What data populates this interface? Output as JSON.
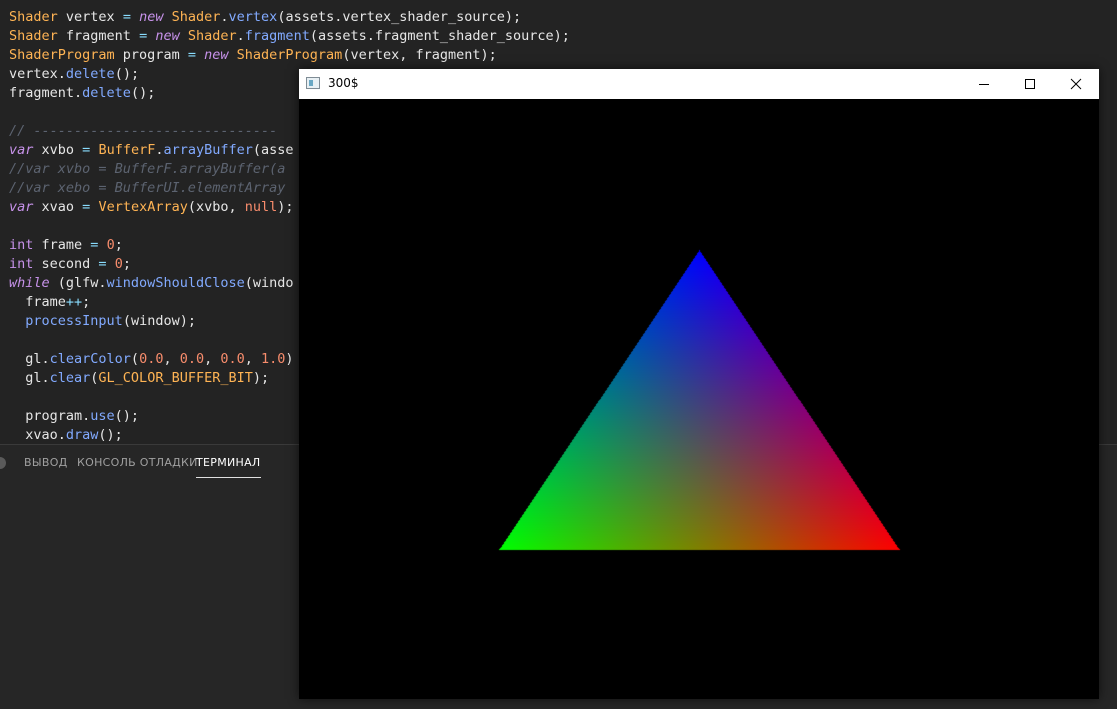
{
  "editor": {
    "lines": [
      [
        [
          "t-type",
          "Shader"
        ],
        [
          "t-plain",
          " vertex "
        ],
        [
          "t-op",
          "="
        ],
        [
          "t-plain",
          " "
        ],
        [
          "t-kw",
          "new"
        ],
        [
          "t-plain",
          " "
        ],
        [
          "t-type",
          "Shader"
        ],
        [
          "t-plain",
          "."
        ],
        [
          "t-call",
          "vertex"
        ],
        [
          "t-plain",
          "(assets.vertex_shader_source);"
        ]
      ],
      [
        [
          "t-type",
          "Shader"
        ],
        [
          "t-plain",
          " fragment "
        ],
        [
          "t-op",
          "="
        ],
        [
          "t-plain",
          " "
        ],
        [
          "t-kw",
          "new"
        ],
        [
          "t-plain",
          " "
        ],
        [
          "t-type",
          "Shader"
        ],
        [
          "t-plain",
          "."
        ],
        [
          "t-call",
          "fragment"
        ],
        [
          "t-plain",
          "(assets.fragment_shader_source);"
        ]
      ],
      [
        [
          "t-type",
          "ShaderProgram"
        ],
        [
          "t-plain",
          " program "
        ],
        [
          "t-op",
          "="
        ],
        [
          "t-plain",
          " "
        ],
        [
          "t-kw",
          "new"
        ],
        [
          "t-plain",
          " "
        ],
        [
          "t-type",
          "ShaderProgram"
        ],
        [
          "t-plain",
          "(vertex, fragment);"
        ]
      ],
      [
        [
          "t-plain",
          "vertex."
        ],
        [
          "t-call",
          "delete"
        ],
        [
          "t-plain",
          "();"
        ]
      ],
      [
        [
          "t-plain",
          "fragment."
        ],
        [
          "t-call",
          "delete"
        ],
        [
          "t-plain",
          "();"
        ]
      ],
      [],
      [
        [
          "t-comment",
          "// ------------------------------"
        ]
      ],
      [
        [
          "t-kw",
          "var"
        ],
        [
          "t-plain",
          " xvbo "
        ],
        [
          "t-op",
          "="
        ],
        [
          "t-plain",
          " "
        ],
        [
          "t-type",
          "BufferF"
        ],
        [
          "t-plain",
          "."
        ],
        [
          "t-call",
          "arrayBuffer"
        ],
        [
          "t-plain",
          "(asse"
        ]
      ],
      [
        [
          "t-comment",
          "//var xvbo = BufferF.arrayBuffer(a"
        ]
      ],
      [
        [
          "t-comment",
          "//var xebo = BufferUI.elementArray"
        ]
      ],
      [
        [
          "t-kw",
          "var"
        ],
        [
          "t-plain",
          " xvao "
        ],
        [
          "t-op",
          "="
        ],
        [
          "t-plain",
          " "
        ],
        [
          "t-type",
          "VertexArray"
        ],
        [
          "t-plain",
          "(xvbo, "
        ],
        [
          "t-null",
          "null"
        ],
        [
          "t-plain",
          ");"
        ]
      ],
      [],
      [
        [
          "t-kw2",
          "int"
        ],
        [
          "t-plain",
          " frame "
        ],
        [
          "t-op",
          "="
        ],
        [
          "t-plain",
          " "
        ],
        [
          "t-num",
          "0"
        ],
        [
          "t-plain",
          ";"
        ]
      ],
      [
        [
          "t-kw2",
          "int"
        ],
        [
          "t-plain",
          " second "
        ],
        [
          "t-op",
          "="
        ],
        [
          "t-plain",
          " "
        ],
        [
          "t-num",
          "0"
        ],
        [
          "t-plain",
          ";"
        ]
      ],
      [
        [
          "t-kw",
          "while"
        ],
        [
          "t-plain",
          " (glfw."
        ],
        [
          "t-call",
          "windowShouldClose"
        ],
        [
          "t-plain",
          "(windo"
        ]
      ],
      [
        [
          "t-plain",
          "  frame"
        ],
        [
          "t-op",
          "++"
        ],
        [
          "t-plain",
          ";"
        ]
      ],
      [
        [
          "t-plain",
          "  "
        ],
        [
          "t-call",
          "processInput"
        ],
        [
          "t-plain",
          "(window);"
        ]
      ],
      [],
      [
        [
          "t-plain",
          "  gl."
        ],
        [
          "t-call",
          "clearColor"
        ],
        [
          "t-plain",
          "("
        ],
        [
          "t-num",
          "0.0"
        ],
        [
          "t-plain",
          ", "
        ],
        [
          "t-num",
          "0.0"
        ],
        [
          "t-plain",
          ", "
        ],
        [
          "t-num",
          "0.0"
        ],
        [
          "t-plain",
          ", "
        ],
        [
          "t-num",
          "1.0"
        ],
        [
          "t-plain",
          ")"
        ]
      ],
      [
        [
          "t-plain",
          "  gl."
        ],
        [
          "t-call",
          "clear"
        ],
        [
          "t-plain",
          "("
        ],
        [
          "t-type",
          "GL_COLOR_BUFFER_BIT"
        ],
        [
          "t-plain",
          ");"
        ]
      ],
      [],
      [
        [
          "t-plain",
          "  program."
        ],
        [
          "t-call",
          "use"
        ],
        [
          "t-plain",
          "();"
        ]
      ],
      [
        [
          "t-plain",
          "  xvao."
        ],
        [
          "t-call",
          "draw"
        ],
        [
          "t-plain",
          "();"
        ]
      ]
    ]
  },
  "panel": {
    "tabs": [
      {
        "label": "ВЫВОД",
        "active": false
      },
      {
        "label": "КОНСОЛЬ ОТЛАДКИ",
        "active": false
      },
      {
        "label": "ТЕРМИНАЛ",
        "active": true
      }
    ]
  },
  "app_window": {
    "title": "300$",
    "controls": [
      "minimize-icon",
      "maximize-icon",
      "close-icon"
    ],
    "triangle_colors": {
      "top": "#0000ff",
      "bottom_left": "#00ff00",
      "bottom_right": "#ff0000"
    }
  }
}
